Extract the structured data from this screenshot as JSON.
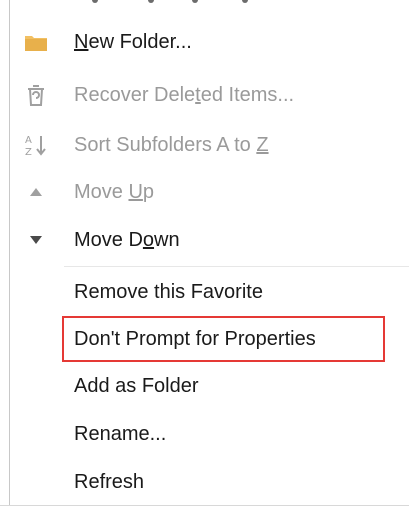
{
  "menu": {
    "items": [
      {
        "pre": "",
        "u": "N",
        "post": "ew Folder...",
        "disabled": false,
        "icon": "folder-icon"
      },
      {
        "pre": "Recover Dele",
        "u": "t",
        "post": "ed Items...",
        "disabled": true,
        "icon": "recover-deleted-icon"
      },
      {
        "pre": "Sort Subfolders A to ",
        "u": "Z",
        "post": "",
        "disabled": true,
        "icon": "sort-az-icon"
      },
      {
        "pre": "Move ",
        "u": "U",
        "post": "p",
        "disabled": true,
        "icon": "triangle-up-icon"
      },
      {
        "pre": "Move D",
        "u": "o",
        "post": "wn",
        "disabled": false,
        "icon": "triangle-down-icon"
      },
      {
        "pre": "Remove this Favorite",
        "u": "",
        "post": "",
        "disabled": false,
        "icon": ""
      },
      {
        "pre": "Don't Prompt for Properties",
        "u": "",
        "post": "",
        "disabled": false,
        "icon": ""
      },
      {
        "pre": "Add as Folder",
        "u": "",
        "post": "",
        "disabled": false,
        "icon": ""
      },
      {
        "pre": "Rename...",
        "u": "",
        "post": "",
        "disabled": false,
        "icon": ""
      },
      {
        "pre": "Refresh",
        "u": "",
        "post": "",
        "disabled": false,
        "icon": ""
      }
    ]
  }
}
